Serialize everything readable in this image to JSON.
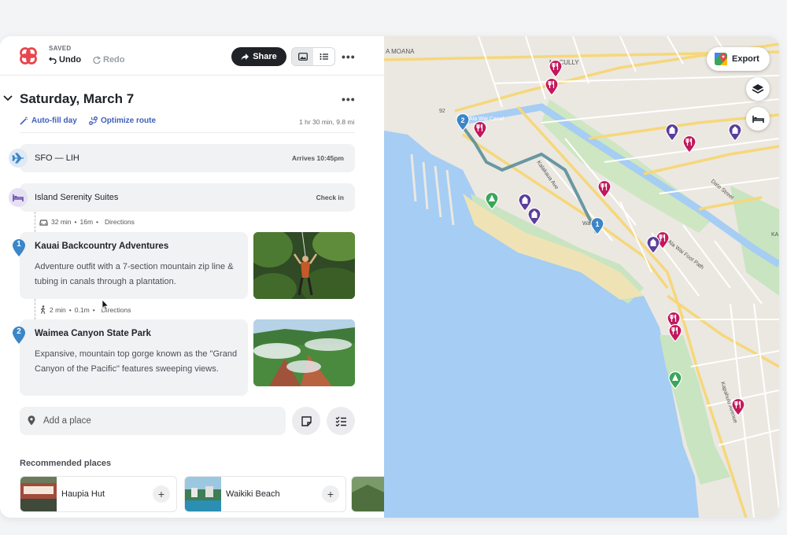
{
  "header": {
    "save_status": "SAVED",
    "undo_label": "Undo",
    "redo_label": "Redo",
    "share_label": "Share"
  },
  "day": {
    "title": "Saturday, March 7",
    "autofill_label": "Auto-fill day",
    "optimize_label": "Optimize route",
    "route_summary": "1 hr 30 min, 9.8 mi"
  },
  "flight": {
    "label": "SFO — LIH",
    "status": "Arrives 10:45pm"
  },
  "hotel": {
    "label": "Island Serenity Suites",
    "action": "Check in"
  },
  "travel1": {
    "time": "32 min",
    "distance": "16m",
    "link": "Directions"
  },
  "travel2": {
    "time": "2 min",
    "distance": "0.1m",
    "link": "Directions"
  },
  "places": [
    {
      "number": "1",
      "name": "Kauai Backcountry Adventures",
      "description": "Adventure outfit with a 7-section mountain zip line & tubing in canals through a plantation."
    },
    {
      "number": "2",
      "name": "Waimea Canyon State Park",
      "description": "Expansive, mountain top gorge known as the \"Grand Canyon of the Pacific\" features sweeping views."
    }
  ],
  "add_place": {
    "placeholder": "Add a place"
  },
  "recommended": {
    "title": "Recommended places",
    "items": [
      {
        "name": "Haupia Hut"
      },
      {
        "name": "Waikiki Beach"
      }
    ]
  },
  "map": {
    "export_label": "Export",
    "street_labels": [
      "A MOANA",
      "MCCULLY",
      "92",
      "Ala Wai Canal",
      "Kalakaua Ave",
      "Date Street",
      "Ala Wai Foot Path",
      "Kapahulu Avenue",
      "Waikiki",
      "KA"
    ],
    "colors": {
      "water": "#a6cdf3",
      "land": "#ebe8e1",
      "park": "#c9e4c0",
      "road": "#f6d77a",
      "route": "#5a8f9a",
      "pin_blue": "#3a86c8",
      "pin_red": "#c2185b",
      "pin_purple": "#5b3d9c",
      "pin_green": "#3aa65a"
    }
  }
}
